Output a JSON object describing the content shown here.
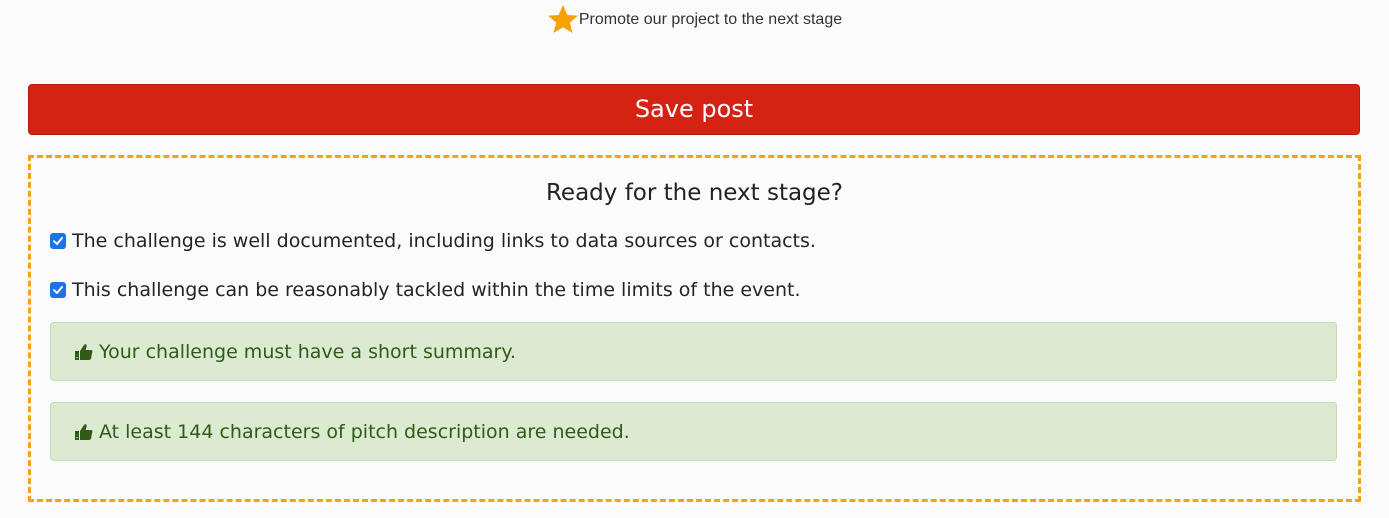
{
  "promote": {
    "icon": "star-icon",
    "label": "Promote our project to the next stage",
    "star_color": "#f6a300"
  },
  "save": {
    "label": "Save post",
    "color": "#d42213"
  },
  "checklist": {
    "title": "Ready for the next stage?",
    "border_color": "#f5a21b",
    "items": [
      {
        "label": "The challenge is well documented, including links to data sources or contacts.",
        "checked": true
      },
      {
        "label": "This challenge can be reasonably tackled within the time limits of the event.",
        "checked": true
      }
    ],
    "alerts": [
      {
        "icon": "thumbs-up-icon",
        "text": "Your challenge must have a short summary."
      },
      {
        "icon": "thumbs-up-icon",
        "text": "At least 144 characters of pitch description are needed."
      }
    ]
  }
}
